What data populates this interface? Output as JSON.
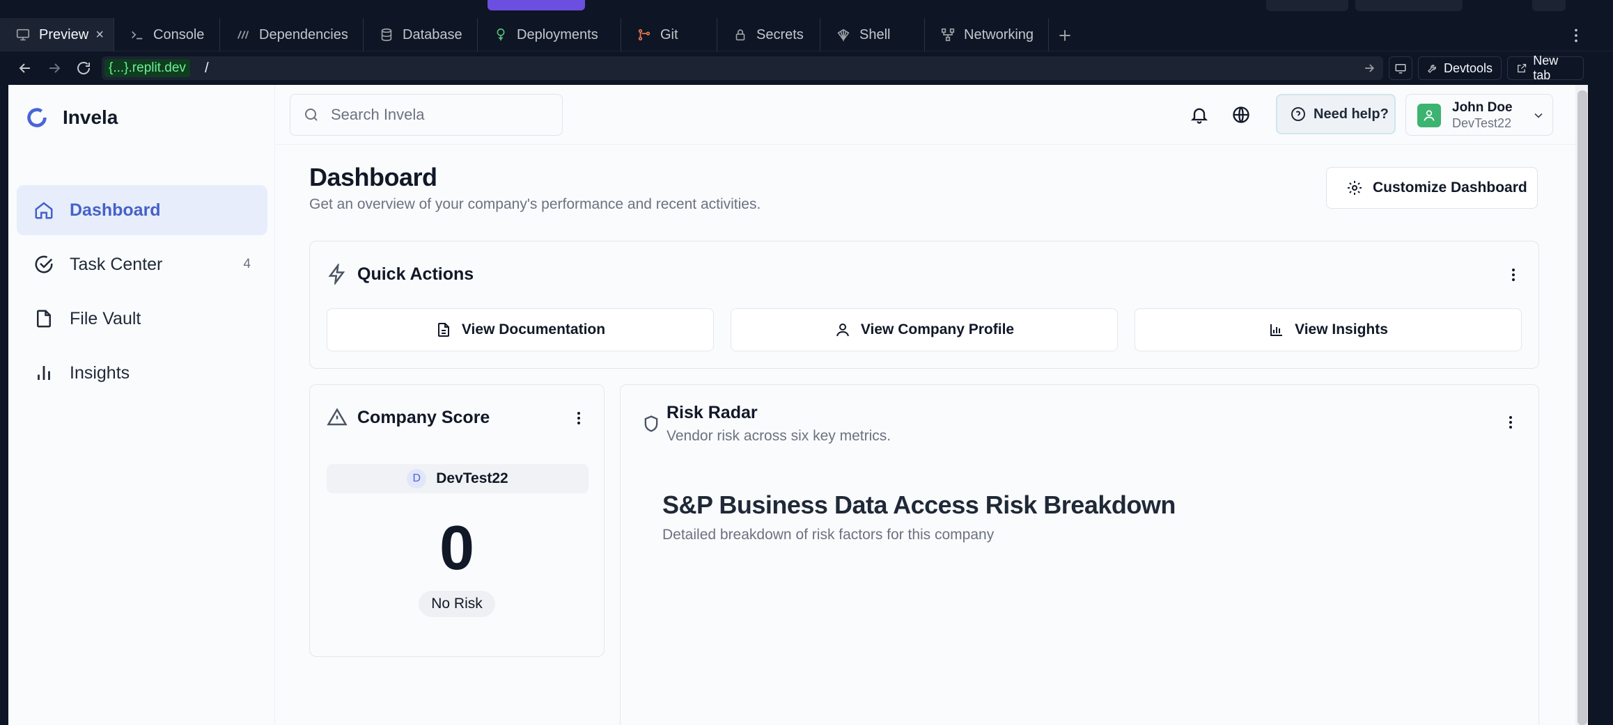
{
  "ide": {
    "tabs": [
      {
        "label": "Preview",
        "icon": "monitor-icon",
        "active": true
      },
      {
        "label": "Console",
        "icon": "terminal-icon"
      },
      {
        "label": "Dependencies",
        "icon": "dependencies-icon"
      },
      {
        "label": "Database",
        "icon": "database-icon"
      },
      {
        "label": "Deployments",
        "icon": "deployments-icon"
      },
      {
        "label": "Git",
        "icon": "git-icon"
      },
      {
        "label": "Secrets",
        "icon": "lock-icon"
      },
      {
        "label": "Shell",
        "icon": "shell-icon"
      },
      {
        "label": "Networking",
        "icon": "network-icon"
      }
    ],
    "tab_close": "×",
    "url": {
      "host": "{...}.replit.dev",
      "path": "/"
    },
    "devtools_label": "Devtools",
    "new_tab_label": "New tab"
  },
  "app": {
    "brand": "Invela",
    "sidebar": [
      {
        "label": "Dashboard",
        "icon": "home-icon",
        "active": true
      },
      {
        "label": "Task Center",
        "icon": "check-circle-icon",
        "count": "4"
      },
      {
        "label": "File Vault",
        "icon": "file-icon"
      },
      {
        "label": "Insights",
        "icon": "bar-chart-icon"
      }
    ],
    "search_placeholder": "Search Invela",
    "help_label": "Need help?",
    "user": {
      "name": "John Doe",
      "org": "DevTest22"
    },
    "page_title": "Dashboard",
    "page_subtitle": "Get an overview of your company's performance and recent activities.",
    "customize_label": "Customize Dashboard",
    "quick_actions": {
      "title": "Quick Actions",
      "buttons": [
        {
          "label": "View Documentation",
          "icon": "document-icon"
        },
        {
          "label": "View Company Profile",
          "icon": "user-icon"
        },
        {
          "label": "View Insights",
          "icon": "bar-chart-icon"
        }
      ]
    },
    "company_score": {
      "title": "Company Score",
      "org_letter": "D",
      "org_name": "DevTest22",
      "score": "0",
      "level": "No Risk"
    },
    "risk_radar": {
      "title": "Risk Radar",
      "subtitle": "Vendor risk across six key metrics.",
      "breakdown_title": "S&P Business Data Access Risk Breakdown",
      "breakdown_subtitle": "Detailed breakdown of risk factors for this company"
    }
  },
  "colors": {
    "accent": "#4965d8",
    "ide_bg": "#0e1525",
    "page_bg": "#fafbfd",
    "avatar": "#3cb371"
  }
}
